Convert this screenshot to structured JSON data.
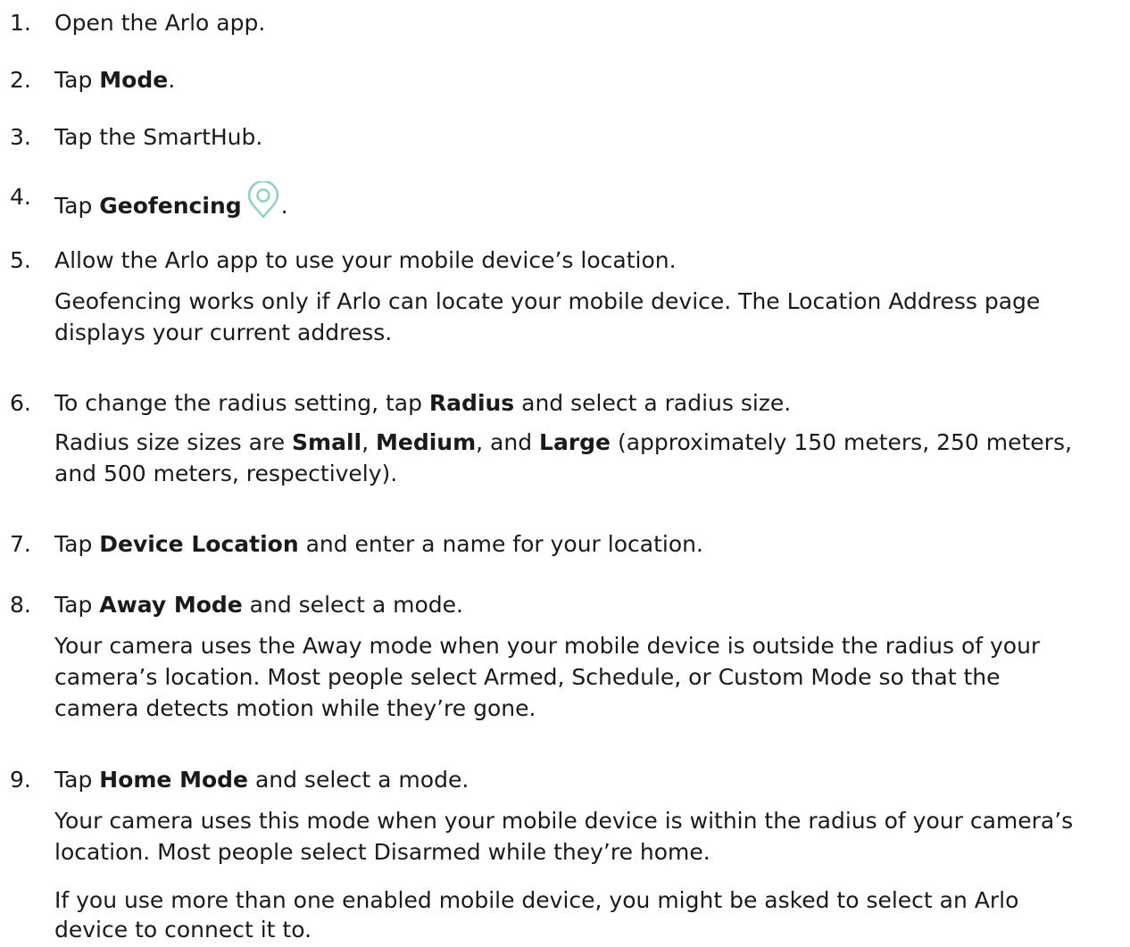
{
  "steps": [
    {
      "num": "1.",
      "parts": [
        "Open the Arlo app."
      ]
    },
    {
      "num": "2.",
      "parts": [
        "Tap ",
        "Mode",
        "."
      ]
    },
    {
      "num": "3.",
      "parts": [
        "Tap the SmartHub."
      ]
    },
    {
      "num": "4.",
      "parts": [
        "Tap ",
        "Geofencing",
        "."
      ]
    },
    {
      "num": "5.",
      "parts": [
        "Allow the Arlo app to use your mobile device’s location."
      ],
      "note": [
        "Geofencing works only if Arlo can locate your mobile device. The Location Address page",
        "displays your current address."
      ]
    },
    {
      "num": "6.",
      "parts": [
        "To change the radius setting, tap ",
        "Radius",
        " and select a radius size."
      ],
      "note1": [
        "Radius size sizes are ",
        "Small",
        ", ",
        "Medium",
        ", and ",
        "Large",
        " (approximately 150 meters, 250 meters,"
      ],
      "note2": "and 500 meters, respectively)."
    },
    {
      "num": "7.",
      "parts": [
        "Tap ",
        "Device Location",
        " and enter a name for your location."
      ]
    },
    {
      "num": "8.",
      "parts": [
        "Tap ",
        "Away Mode",
        " and select a mode."
      ],
      "note": [
        "Your camera uses the Away mode when your mobile device is outside the radius of your",
        "camera’s location. Most people select Armed, Schedule, or Custom Mode so that the",
        "camera detects motion while they’re gone."
      ]
    },
    {
      "num": "9.",
      "parts": [
        "Tap ",
        "Home Mode",
        " and select a mode."
      ],
      "note": [
        "Your camera uses this mode when your mobile device is within the radius of your camera’s",
        "location. Most people select Disarmed while they’re home."
      ],
      "note_extra": [
        "If you use more than one enabled mobile device, you might be asked to select an Arlo",
        "device to connect it to."
      ]
    }
  ],
  "icons": {
    "geofencing": "location-pin-icon"
  },
  "colors": {
    "icon": "#8fd3b6",
    "text": "#1a1a1a"
  }
}
